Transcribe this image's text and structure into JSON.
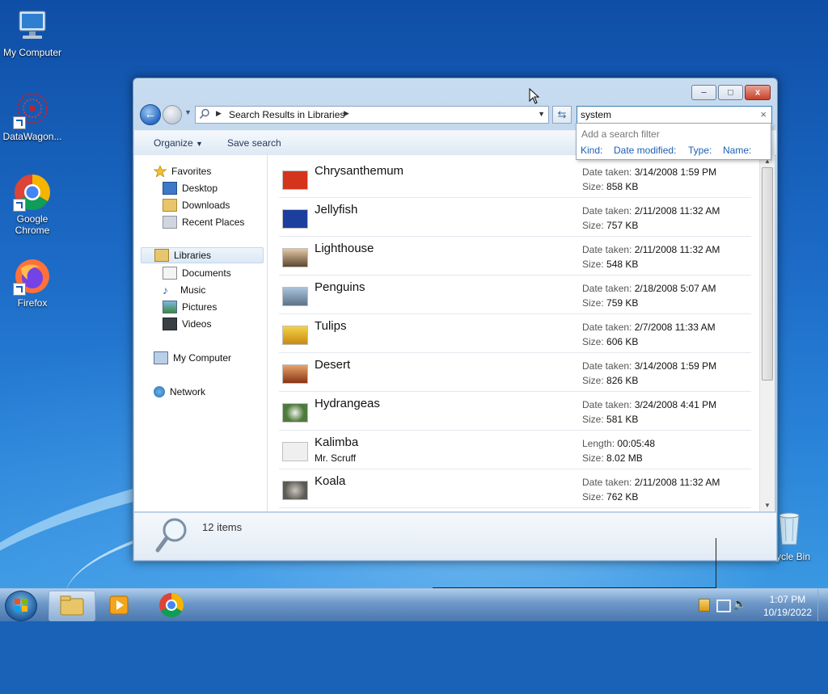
{
  "desktop": {
    "icons": [
      {
        "label": "My Computer"
      },
      {
        "label": "DataWagon..."
      },
      {
        "label": "Google Chrome"
      },
      {
        "label": "Firefox"
      },
      {
        "label": "ycle Bin"
      }
    ]
  },
  "window": {
    "controls": {
      "minimize": "–",
      "maximize": "□",
      "close": "x"
    },
    "address": {
      "path": "Search Results in Libraries"
    },
    "search": {
      "value": "system",
      "clear": "×"
    },
    "filter_popup": {
      "heading": "Add a search filter",
      "filters": [
        "Kind:",
        "Date modified:",
        "Type:",
        "Name:"
      ]
    },
    "toolbar": {
      "organize": "Organize",
      "save_search": "Save search"
    },
    "nav": {
      "favorites": "Favorites",
      "desktop": "Desktop",
      "downloads": "Downloads",
      "recent_places": "Recent Places",
      "libraries": "Libraries",
      "documents": "Documents",
      "music": "Music",
      "pictures": "Pictures",
      "videos": "Videos",
      "my_computer": "My Computer",
      "network": "Network"
    },
    "results": [
      {
        "name": "Chrysanthemum",
        "m1_label": "Date taken:",
        "m1_value": "3/14/2008 1:59 PM",
        "m2_label": "Size:",
        "m2_value": "858 KB",
        "color": "#d4341c"
      },
      {
        "name": "Jellyfish",
        "m1_label": "Date taken:",
        "m1_value": "2/11/2008 11:32 AM",
        "m2_label": "Size:",
        "m2_value": "757 KB",
        "color": "#1c3e9e"
      },
      {
        "name": "Lighthouse",
        "m1_label": "Date taken:",
        "m1_value": "2/11/2008 11:32 AM",
        "m2_label": "Size:",
        "m2_value": "548 KB",
        "color": "#6b5a3a"
      },
      {
        "name": "Penguins",
        "m1_label": "Date taken:",
        "m1_value": "2/18/2008 5:07 AM",
        "m2_label": "Size:",
        "m2_value": "759 KB",
        "color": "#7d9bb8"
      },
      {
        "name": "Tulips",
        "m1_label": "Date taken:",
        "m1_value": "2/7/2008 11:33 AM",
        "m2_label": "Size:",
        "m2_value": "606 KB",
        "color": "#e0b21c"
      },
      {
        "name": "Desert",
        "m1_label": "Date taken:",
        "m1_value": "3/14/2008 1:59 PM",
        "m2_label": "Size:",
        "m2_value": "826 KB",
        "color": "#a9481e"
      },
      {
        "name": "Hydrangeas",
        "m1_label": "Date taken:",
        "m1_value": "3/24/2008 4:41 PM",
        "m2_label": "Size:",
        "m2_value": "581 KB",
        "color": "#4e7a3c"
      },
      {
        "name": "Kalimba",
        "sub": "Mr. Scruff",
        "m1_label": "Length:",
        "m1_value": "00:05:48",
        "m2_label": "Size:",
        "m2_value": "8.02 MB",
        "color": "#e8e8e8"
      },
      {
        "name": "Koala",
        "m1_label": "Date taken:",
        "m1_value": "2/11/2008 11:32 AM",
        "m2_label": "Size:",
        "m2_value": "762 KB",
        "color": "#8c8a80"
      }
    ],
    "details": {
      "count": "12 items"
    }
  },
  "taskbar": {
    "clock_time": "1:07 PM",
    "clock_date": "10/19/2022"
  }
}
